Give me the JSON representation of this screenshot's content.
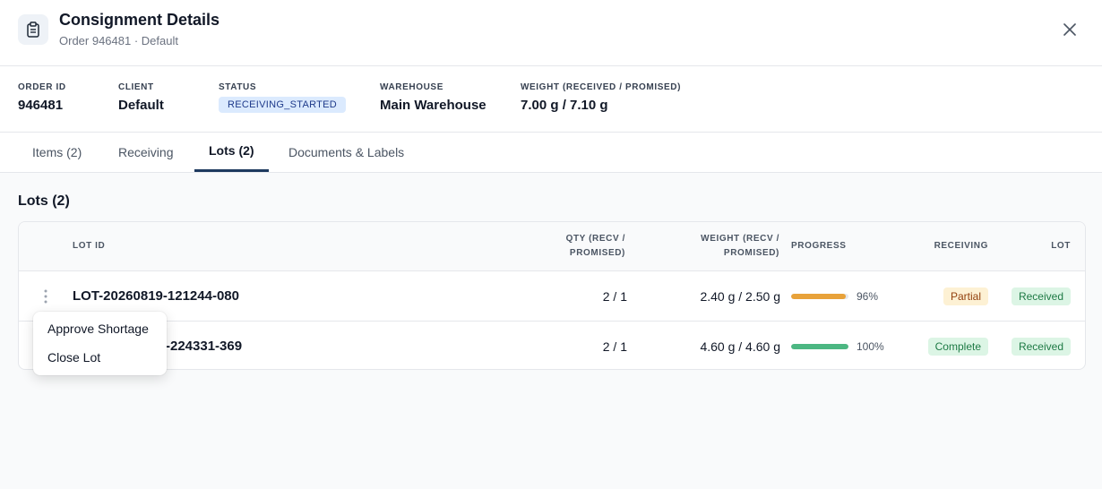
{
  "header": {
    "icon": "clipboard-icon",
    "title": "Consignment Details",
    "subtitle": "Order 946481 · Default",
    "close_icon": "close-icon"
  },
  "summary": {
    "order_id": {
      "label": "ORDER ID",
      "value": "946481"
    },
    "client": {
      "label": "CLIENT",
      "value": "Default"
    },
    "status": {
      "label": "STATUS",
      "value": "RECEIVING_STARTED"
    },
    "warehouse": {
      "label": "WAREHOUSE",
      "value": "Main Warehouse"
    },
    "weight": {
      "label": "WEIGHT (RECEIVED / PROMISED)",
      "value": "7.00 g / 7.10 g"
    }
  },
  "tabs": [
    {
      "label": "Items (2)",
      "active": false
    },
    {
      "label": "Receiving",
      "active": false
    },
    {
      "label": "Lots (2)",
      "active": true
    },
    {
      "label": "Documents & Labels",
      "active": false
    }
  ],
  "lots": {
    "title": "Lots (2)",
    "columns": {
      "lot_id": "LOT ID",
      "qty_line1": "QTY (RECV /",
      "qty_line2": "PROMISED)",
      "weight_line1": "WEIGHT (RECV /",
      "weight_line2": "PROMISED)",
      "progress": "PROGRESS",
      "receiving": "RECEIVING",
      "lot": "LOT"
    },
    "rows": [
      {
        "lot_id": "LOT-20260819-121244-080",
        "qty": "2 / 1",
        "weight": "2.40 g / 2.50 g",
        "progress": 0.96,
        "progress_label": "96%",
        "progress_color": "#e8a23a",
        "receiving": "Partial",
        "lot_status": "Received"
      },
      {
        "lot_id_visible": "-224331-369",
        "qty": "2 / 1",
        "weight": "4.60 g / 4.60 g",
        "progress": 1.0,
        "progress_label": "100%",
        "progress_color": "#4cb782",
        "receiving": "Complete",
        "lot_status": "Received"
      }
    ]
  },
  "context_menu": {
    "items": [
      "Approve Shortage",
      "Close Lot"
    ]
  },
  "colors": {
    "accent": "#1e3a5f",
    "status_pill_bg": "#dbeafe",
    "partial_bg": "#fdf1d4",
    "partial_text": "#92400e",
    "green_bg": "#dcf5e5",
    "green_text": "#1e7a45"
  }
}
